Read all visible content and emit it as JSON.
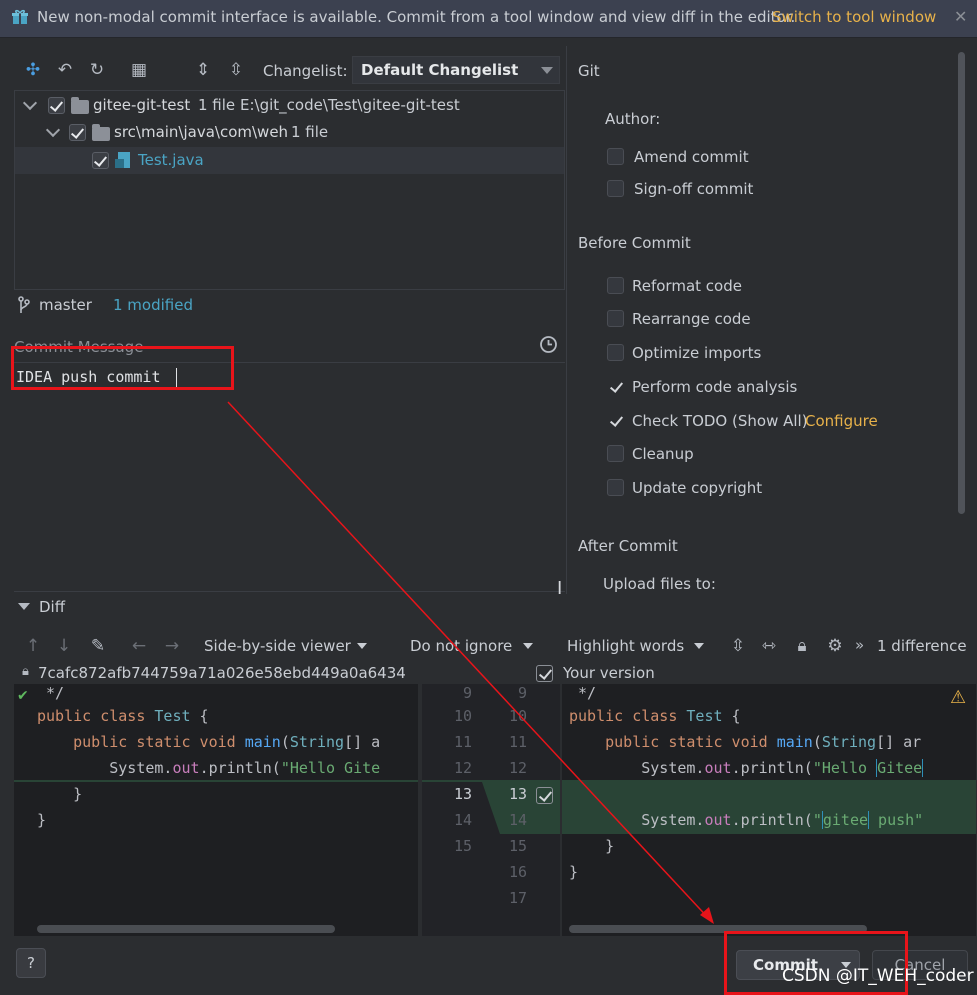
{
  "banner": {
    "text": "New non-modal commit interface is available. Commit from a tool window and view diff in the editor.",
    "link": "Switch to tool window"
  },
  "toolbar": {
    "changelist_label": "Changelist:",
    "changelist_value": "Default Changelist"
  },
  "tree": {
    "root": {
      "name": "gitee-git-test",
      "count": "1 file",
      "path": "E:\\git_code\\Test\\gitee-git-test"
    },
    "folder": {
      "name": "src\\main\\java\\com\\weh",
      "count": "1 file"
    },
    "file": {
      "name": "Test.java"
    }
  },
  "status": {
    "branch": "master",
    "modified": "1 modified"
  },
  "commit": {
    "label": "Commit Message",
    "message": "IDEA push commit"
  },
  "git_panel": {
    "title": "Git",
    "author_label": "Author:",
    "amend": "Amend commit",
    "signoff": "Sign-off commit",
    "before_title": "Before Commit",
    "before_items": [
      {
        "label": "Reformat code",
        "checked": false
      },
      {
        "label": "Rearrange code",
        "checked": false
      },
      {
        "label": "Optimize imports",
        "checked": false
      },
      {
        "label": "Perform code analysis",
        "checked": true
      },
      {
        "label": "Check TODO (Show All)",
        "checked": true
      },
      {
        "label": "Cleanup",
        "checked": false
      },
      {
        "label": "Update copyright",
        "checked": false
      }
    ],
    "configure": "Configure",
    "after_title": "After Commit",
    "upload_label": "Upload files to:"
  },
  "diff": {
    "title": "Diff",
    "viewer": "Side-by-side viewer",
    "ignore": "Do not ignore",
    "highlight": "Highlight words",
    "differences": "1 difference",
    "left_revision": "7cafc872afb744759a71a026e58ebd449a0a6434",
    "right_revision": "Your version",
    "left_lines": {
      "l9": " */",
      "l10a": "public class ",
      "l10b": "Test",
      "l10c": " {",
      "l11a": "    public static void ",
      "l11b": "main",
      "l11c": "(",
      "l11d": "String",
      "l11e": "[] a",
      "l12a": "        System.",
      "l12b": "out",
      "l12c": ".println(",
      "l12d": "\"Hello Gite",
      "l13": "    }",
      "l14": "}"
    },
    "right_lines": {
      "l9": " */",
      "l10a": "public class ",
      "l10b": "Test",
      "l10c": " {",
      "l11a": "    public static void ",
      "l11b": "main",
      "l11c": "(",
      "l11d": "String",
      "l11e": "[] ar",
      "l12a": "        System.",
      "l12b": "out",
      "l12c": ".println(",
      "l12d": "\"Hello ",
      "l12e": "Gitee",
      "l14a": "        System.",
      "l14b": "out",
      "l14c": ".println(",
      "l14d": "\"",
      "l14e": "gitee",
      "l14f": " push\"",
      "l15": "    }",
      "l16": "}"
    },
    "left_numbers": [
      "9",
      "10",
      "11",
      "12",
      "13",
      "14",
      "15"
    ],
    "right_numbers": [
      "9",
      "10",
      "11",
      "12",
      "13",
      "14",
      "15",
      "16",
      "17"
    ]
  },
  "buttons": {
    "help": "?",
    "commit": "Commit",
    "cancel": "Cancel"
  },
  "watermark": "CSDN @IT_WEH_coder",
  "colors": {
    "accent_link": "#e8b24a",
    "highlight_red": "#e8141a",
    "added_green": "#294436"
  }
}
